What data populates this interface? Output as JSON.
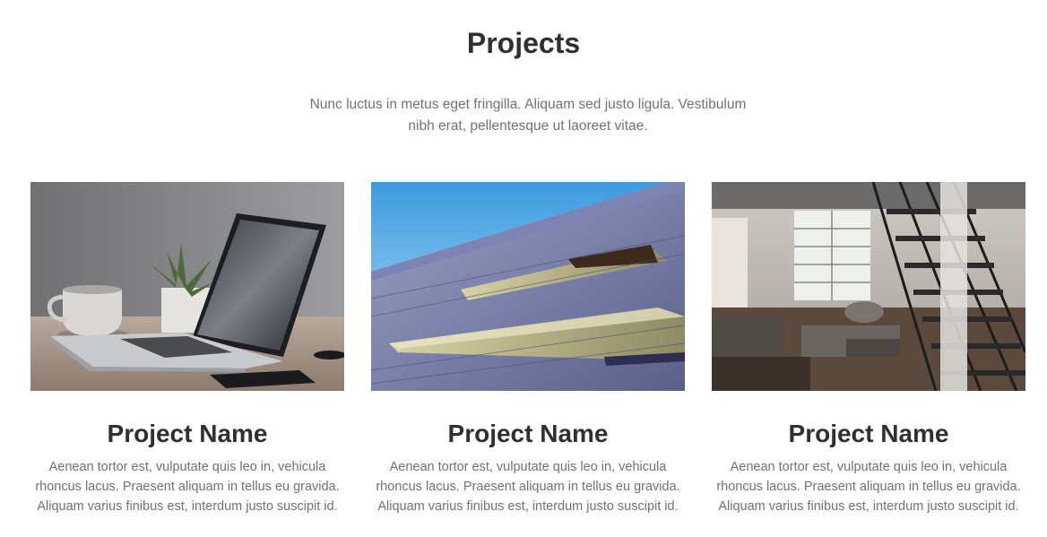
{
  "section": {
    "title": "Projects",
    "intro": "Nunc luctus in metus eget fringilla. Aliquam sed justo ligula. Vestibulum nibh erat, pellentesque ut laoreet vitae."
  },
  "projects": [
    {
      "name": "Project Name",
      "description": "Aenean tortor est, vulputate quis leo in, vehicula rhoncus lacus. Praesent aliquam in tellus eu gravida. Aliquam varius finibus est, interdum justo suscipit id.",
      "image": "laptop-on-desk-photo"
    },
    {
      "name": "Project Name",
      "description": "Aenean tortor est, vulputate quis leo in, vehicula rhoncus lacus. Praesent aliquam in tellus eu gravida. Aliquam varius finibus est, interdum justo suscipit id.",
      "image": "building-facade-photo"
    },
    {
      "name": "Project Name",
      "description": "Aenean tortor est, vulputate quis leo in, vehicula rhoncus lacus. Praesent aliquam in tellus eu gravida. Aliquam varius finibus est, interdum justo suscipit id.",
      "image": "loft-interior-staircase-photo"
    }
  ]
}
